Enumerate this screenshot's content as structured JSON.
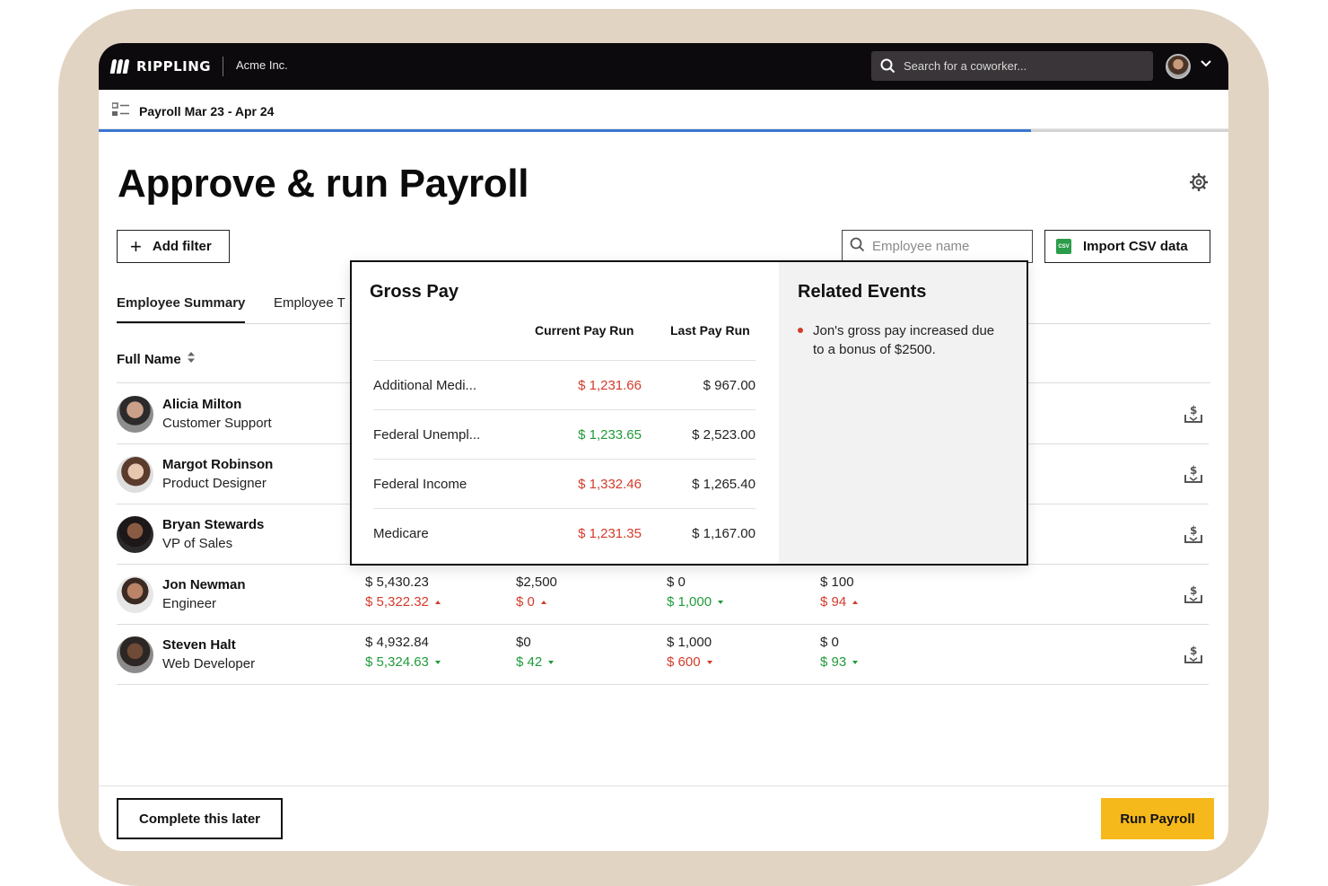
{
  "app": {
    "brand": "RIPPLING",
    "company": "Acme Inc.",
    "search_placeholder": "Search for a coworker..."
  },
  "subbar": {
    "title": "Payroll Mar 23 - Apr 24",
    "progress": 0.825
  },
  "page": {
    "title": "Approve & run Payroll",
    "add_filter": "Add filter",
    "employee_search_placeholder": "Employee name",
    "import_label": "Import CSV data",
    "csv_badge": "CSV"
  },
  "tabs": [
    "Employee Summary",
    "Employee T"
  ],
  "table": {
    "full_name_header": "Full Name",
    "rows": [
      {
        "name": "Alicia Milton",
        "role": "Customer Support"
      },
      {
        "name": "Margot Robinson",
        "role": "Product Designer"
      },
      {
        "name": "Bryan Stewards",
        "role": "VP of Sales"
      },
      {
        "name": "Jon Newman",
        "role": "Engineer",
        "c1_top": "$ 5,430.23",
        "c1_bot": "$ 5,322.32",
        "c2_top": "$2,500",
        "c2_bot": "$ 0",
        "c3_top": "$ 0",
        "c3_bot": "$ 1,000",
        "c4_top": "$ 100",
        "c4_bot": "$ 94"
      },
      {
        "name": "Steven Halt",
        "role": "Web Developer",
        "c1_top": "$ 4,932.84",
        "c1_bot": "$ 5,324.63",
        "c2_top": "$0",
        "c2_bot": "$ 42",
        "c3_top": "$ 1,000",
        "c3_bot": "$ 600",
        "c4_top": "$ 0",
        "c4_bot": "$ 93"
      }
    ]
  },
  "popover": {
    "title": "Gross Pay",
    "col_current": "Current Pay Run",
    "col_last": "Last Pay Run",
    "rows": [
      {
        "label": "Additional Medi...",
        "current": "$ 1,231.66",
        "last": "$ 967.00"
      },
      {
        "label": "Federal Unempl...",
        "current": "$ 1,233.65",
        "last": "$ 2,523.00"
      },
      {
        "label": "Federal Income",
        "current": "$ 1,332.46",
        "last": "$ 1,265.40"
      },
      {
        "label": "Medicare",
        "current": "$ 1,231.35",
        "last": "$ 1,167.00"
      }
    ],
    "related_title": "Related Events",
    "related_text": "Jon's gross pay increased due to a bonus of $2500."
  },
  "footer": {
    "later": "Complete this later",
    "run": "Run Payroll"
  },
  "colors": {
    "accent_blue": "#3b76d1",
    "run_button": "#f6b91b",
    "negative": "#d33b2b",
    "positive": "#1f9a3a"
  }
}
